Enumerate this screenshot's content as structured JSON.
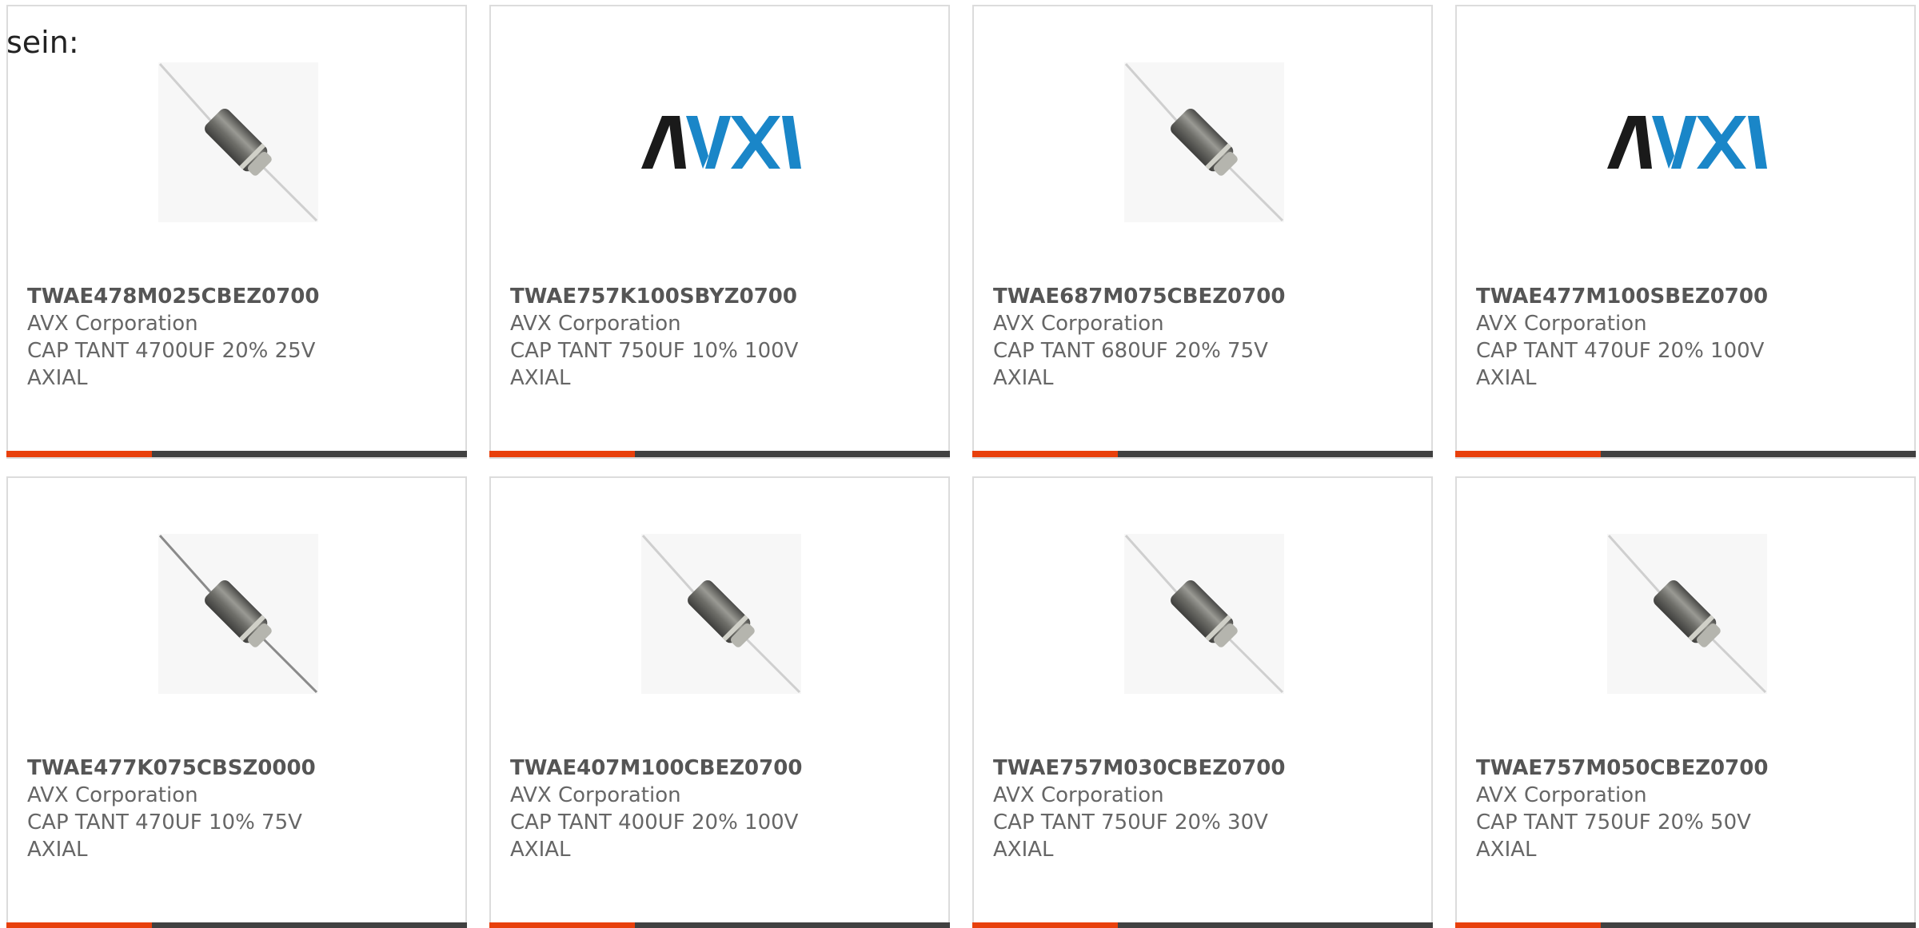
{
  "intro_text": "sein:",
  "colors": {
    "accent": "#e8400c",
    "bar": "#414141",
    "card_border": "#dcdcdc",
    "text": "#666666",
    "avx_black": "#1a1a1a",
    "avx_blue": "#1a86c8"
  },
  "products": [
    {
      "part": "TWAE478M025CBEZ0700",
      "manufacturer": "AVX Corporation",
      "description": "CAP TANT 4700UF 20% 25V AXIAL",
      "image": "axial-capacitor-photo"
    },
    {
      "part": "TWAE757K100SBYZ0700",
      "manufacturer": "AVX Corporation",
      "description": "CAP TANT 750UF 10% 100V AXIAL",
      "image": "avx-logo"
    },
    {
      "part": "TWAE687M075CBEZ0700",
      "manufacturer": "AVX Corporation",
      "description": "CAP TANT 680UF 20% 75V AXIAL",
      "image": "axial-capacitor-photo"
    },
    {
      "part": "TWAE477M100SBEZ0700",
      "manufacturer": "AVX Corporation",
      "description": "CAP TANT 470UF 20% 100V AXIAL",
      "image": "avx-logo"
    },
    {
      "part": "TWAE477K075CBSZ0000",
      "manufacturer": "AVX Corporation",
      "description": "CAP TANT 470UF 10% 75V AXIAL",
      "image": "axial-capacitor-photo"
    },
    {
      "part": "TWAE407M100CBEZ0700",
      "manufacturer": "AVX Corporation",
      "description": "CAP TANT 400UF 20% 100V AXIAL",
      "image": "axial-capacitor-photo"
    },
    {
      "part": "TWAE757M030CBEZ0700",
      "manufacturer": "AVX Corporation",
      "description": "CAP TANT 750UF 20% 30V AXIAL",
      "image": "axial-capacitor-photo"
    },
    {
      "part": "TWAE757M050CBEZ0700",
      "manufacturer": "AVX Corporation",
      "description": "CAP TANT 750UF 20% 50V AXIAL",
      "image": "axial-capacitor-photo"
    }
  ]
}
